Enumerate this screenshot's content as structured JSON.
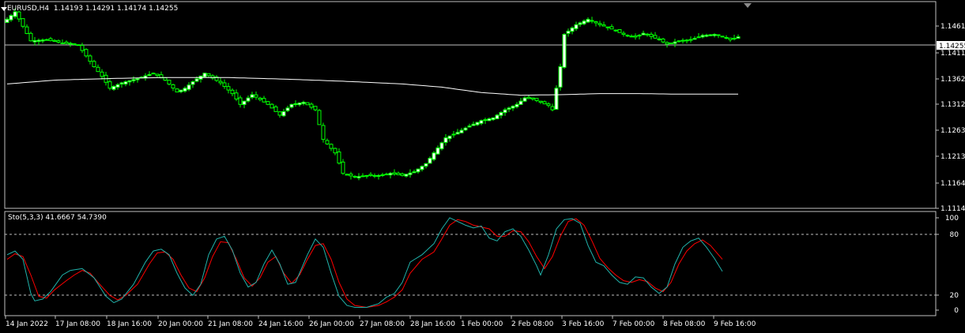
{
  "header": {
    "symbol": "EURUSD,H4",
    "ohlc": "1.14193 1.14291 1.14174 1.14255"
  },
  "indicator": {
    "label": "Sto(5,3,3) 41.6667 54.7390"
  },
  "colors": {
    "background": "#000000",
    "bull_candle": "#00ff00",
    "bull_body": "#ffffff",
    "bear_candle": "#00ff00",
    "bear_body": "#000000",
    "ma_line": "#ffffff",
    "stoch_main": "#20b2aa",
    "stoch_signal": "#ff0000",
    "axis": "#c0c0c0",
    "bid_line": "#c0c0c0",
    "price_tag_bg": "#ffffff"
  },
  "price_axis": {
    "labels": [
      "1.14610",
      "1.14110",
      "1.13620",
      "1.13120",
      "1.12630",
      "1.12130",
      "1.11640",
      "1.11140"
    ],
    "current": "1.14255"
  },
  "stoch_axis": {
    "labels": [
      "100",
      "80",
      "20",
      "0"
    ]
  },
  "time_axis": {
    "labels": [
      "14 Jan 2022",
      "17 Jan 08:00",
      "18 Jan 16:00",
      "20 Jan 00:00",
      "21 Jan 08:00",
      "24 Jan 16:00",
      "26 Jan 00:00",
      "27 Jan 08:00",
      "28 Jan 16:00",
      "1 Feb 00:00",
      "2 Feb 08:00",
      "3 Feb 16:00",
      "7 Feb 00:00",
      "8 Feb 08:00",
      "9 Feb 16:00"
    ]
  },
  "chart_data": [
    {
      "type": "candlestick",
      "title": "EURUSD,H4",
      "ylim": [
        1.111,
        1.1485
      ],
      "close_anchors": [
        [
          0,
          1.1458
        ],
        [
          2,
          1.1472
        ],
        [
          4,
          1.1445
        ],
        [
          6,
          1.1418
        ],
        [
          10,
          1.142
        ],
        [
          14,
          1.1414
        ],
        [
          18,
          1.141
        ],
        [
          20,
          1.139
        ],
        [
          22,
          1.137
        ],
        [
          24,
          1.1352
        ],
        [
          26,
          1.133
        ],
        [
          29,
          1.134
        ],
        [
          33,
          1.1348
        ],
        [
          37,
          1.1358
        ],
        [
          40,
          1.1345
        ],
        [
          43,
          1.1323
        ],
        [
          45,
          1.133
        ],
        [
          47,
          1.1342
        ],
        [
          50,
          1.1358
        ],
        [
          54,
          1.134
        ],
        [
          57,
          1.132
        ],
        [
          59,
          1.13
        ],
        [
          62,
          1.1318
        ],
        [
          66,
          1.13
        ],
        [
          69,
          1.128
        ],
        [
          72,
          1.13
        ],
        [
          75,
          1.1304
        ],
        [
          78,
          1.129
        ],
        [
          80,
          1.1235
        ],
        [
          83,
          1.121
        ],
        [
          85,
          1.1172
        ],
        [
          88,
          1.1165
        ],
        [
          91,
          1.1168
        ],
        [
          94,
          1.1168
        ],
        [
          97,
          1.1172
        ],
        [
          100,
          1.1168
        ],
        [
          103,
          1.1175
        ],
        [
          106,
          1.119
        ],
        [
          108,
          1.121
        ],
        [
          111,
          1.1238
        ],
        [
          114,
          1.1248
        ],
        [
          117,
          1.126
        ],
        [
          120,
          1.127
        ],
        [
          123,
          1.1275
        ],
        [
          126,
          1.129
        ],
        [
          129,
          1.13
        ],
        [
          131,
          1.1312
        ],
        [
          133,
          1.131
        ],
        [
          135,
          1.1304
        ],
        [
          137,
          1.1298
        ],
        [
          138,
          1.129
        ],
        [
          139,
          1.133
        ],
        [
          140,
          1.137
        ],
        [
          141,
          1.143
        ],
        [
          144,
          1.1448
        ],
        [
          147,
          1.1458
        ],
        [
          150,
          1.1448
        ],
        [
          153,
          1.144
        ],
        [
          156,
          1.143
        ],
        [
          159,
          1.1425
        ],
        [
          161,
          1.1432
        ],
        [
          163,
          1.1426
        ],
        [
          165,
          1.142
        ],
        [
          167,
          1.1412
        ],
        [
          170,
          1.1418
        ],
        [
          173,
          1.142
        ],
        [
          176,
          1.1428
        ],
        [
          179,
          1.143
        ],
        [
          181,
          1.1426
        ],
        [
          183,
          1.142
        ],
        [
          185,
          1.14255
        ]
      ],
      "ma_anchors": [
        [
          0,
          1.1338
        ],
        [
          12,
          1.1345
        ],
        [
          26,
          1.1348
        ],
        [
          40,
          1.135
        ],
        [
          55,
          1.135
        ],
        [
          70,
          1.1347
        ],
        [
          85,
          1.1343
        ],
        [
          100,
          1.1338
        ],
        [
          110,
          1.1332
        ],
        [
          120,
          1.1322
        ],
        [
          130,
          1.1317
        ],
        [
          140,
          1.1318
        ],
        [
          150,
          1.132
        ],
        [
          160,
          1.132
        ],
        [
          170,
          1.1319
        ],
        [
          185,
          1.1319
        ]
      ]
    },
    {
      "type": "line",
      "title": "Sto(5,3,3)",
      "ylim": [
        0,
        100
      ],
      "levels": [
        80,
        20
      ],
      "main_anchors": [
        [
          0,
          60
        ],
        [
          2,
          64
        ],
        [
          4,
          55
        ],
        [
          6,
          18
        ],
        [
          7,
          10
        ],
        [
          9,
          12
        ],
        [
          11,
          20
        ],
        [
          14,
          38
        ],
        [
          16,
          43
        ],
        [
          19,
          45
        ],
        [
          22,
          35
        ],
        [
          25,
          15
        ],
        [
          27,
          8
        ],
        [
          29,
          12
        ],
        [
          32,
          28
        ],
        [
          35,
          52
        ],
        [
          37,
          64
        ],
        [
          39,
          66
        ],
        [
          41,
          60
        ],
        [
          43,
          40
        ],
        [
          45,
          24
        ],
        [
          47,
          16
        ],
        [
          49,
          28
        ],
        [
          51,
          60
        ],
        [
          53,
          77
        ],
        [
          55,
          80
        ],
        [
          57,
          65
        ],
        [
          59,
          40
        ],
        [
          61,
          25
        ],
        [
          63,
          30
        ],
        [
          65,
          50
        ],
        [
          67,
          65
        ],
        [
          69,
          50
        ],
        [
          71,
          28
        ],
        [
          73,
          30
        ],
        [
          76,
          60
        ],
        [
          78,
          77
        ],
        [
          80,
          68
        ],
        [
          82,
          40
        ],
        [
          84,
          15
        ],
        [
          86,
          5
        ],
        [
          88,
          3
        ],
        [
          91,
          3
        ],
        [
          94,
          7
        ],
        [
          96,
          14
        ],
        [
          98,
          18
        ],
        [
          100,
          30
        ],
        [
          102,
          52
        ],
        [
          105,
          60
        ],
        [
          108,
          72
        ],
        [
          110,
          88
        ],
        [
          112,
          100
        ],
        [
          114,
          96
        ],
        [
          116,
          92
        ],
        [
          118,
          89
        ],
        [
          120,
          91
        ],
        [
          122,
          78
        ],
        [
          124,
          75
        ],
        [
          126,
          85
        ],
        [
          128,
          88
        ],
        [
          130,
          80
        ],
        [
          132,
          65
        ],
        [
          134,
          48
        ],
        [
          135,
          38
        ],
        [
          137,
          60
        ],
        [
          139,
          88
        ],
        [
          141,
          98
        ],
        [
          143,
          99
        ],
        [
          145,
          94
        ],
        [
          147,
          70
        ],
        [
          149,
          52
        ],
        [
          151,
          48
        ],
        [
          153,
          38
        ],
        [
          155,
          30
        ],
        [
          157,
          28
        ],
        [
          159,
          36
        ],
        [
          161,
          35
        ],
        [
          163,
          25
        ],
        [
          165,
          18
        ],
        [
          167,
          25
        ],
        [
          169,
          50
        ],
        [
          171,
          68
        ],
        [
          173,
          75
        ],
        [
          175,
          78
        ],
        [
          177,
          68
        ],
        [
          179,
          56
        ],
        [
          181,
          42
        ]
      ],
      "signal_anchors": [
        [
          0,
          55
        ],
        [
          2,
          61
        ],
        [
          4,
          58
        ],
        [
          6,
          38
        ],
        [
          8,
          15
        ],
        [
          10,
          13
        ],
        [
          12,
          22
        ],
        [
          15,
          32
        ],
        [
          17,
          38
        ],
        [
          19,
          43
        ],
        [
          21,
          40
        ],
        [
          23,
          30
        ],
        [
          26,
          16
        ],
        [
          28,
          11
        ],
        [
          30,
          16
        ],
        [
          33,
          28
        ],
        [
          36,
          50
        ],
        [
          38,
          62
        ],
        [
          40,
          63
        ],
        [
          42,
          55
        ],
        [
          44,
          38
        ],
        [
          46,
          24
        ],
        [
          48,
          20
        ],
        [
          50,
          35
        ],
        [
          52,
          58
        ],
        [
          54,
          74
        ],
        [
          56,
          73
        ],
        [
          58,
          55
        ],
        [
          60,
          35
        ],
        [
          62,
          26
        ],
        [
          64,
          35
        ],
        [
          66,
          52
        ],
        [
          68,
          58
        ],
        [
          70,
          40
        ],
        [
          72,
          29
        ],
        [
          74,
          38
        ],
        [
          76,
          55
        ],
        [
          78,
          70
        ],
        [
          80,
          72
        ],
        [
          82,
          55
        ],
        [
          84,
          30
        ],
        [
          86,
          12
        ],
        [
          88,
          5
        ],
        [
          91,
          3
        ],
        [
          94,
          5
        ],
        [
          96,
          9
        ],
        [
          98,
          14
        ],
        [
          100,
          22
        ],
        [
          102,
          40
        ],
        [
          105,
          55
        ],
        [
          108,
          63
        ],
        [
          110,
          77
        ],
        [
          112,
          92
        ],
        [
          114,
          98
        ],
        [
          116,
          96
        ],
        [
          118,
          92
        ],
        [
          120,
          90
        ],
        [
          122,
          88
        ],
        [
          124,
          80
        ],
        [
          126,
          80
        ],
        [
          128,
          86
        ],
        [
          130,
          85
        ],
        [
          132,
          74
        ],
        [
          134,
          58
        ],
        [
          136,
          45
        ],
        [
          138,
          58
        ],
        [
          140,
          80
        ],
        [
          142,
          96
        ],
        [
          144,
          99
        ],
        [
          146,
          92
        ],
        [
          148,
          75
        ],
        [
          150,
          56
        ],
        [
          152,
          46
        ],
        [
          154,
          38
        ],
        [
          156,
          32
        ],
        [
          158,
          30
        ],
        [
          160,
          33
        ],
        [
          162,
          31
        ],
        [
          164,
          24
        ],
        [
          166,
          20
        ],
        [
          168,
          30
        ],
        [
          170,
          50
        ],
        [
          172,
          64
        ],
        [
          174,
          72
        ],
        [
          176,
          76
        ],
        [
          178,
          70
        ],
        [
          181,
          55
        ]
      ]
    }
  ]
}
